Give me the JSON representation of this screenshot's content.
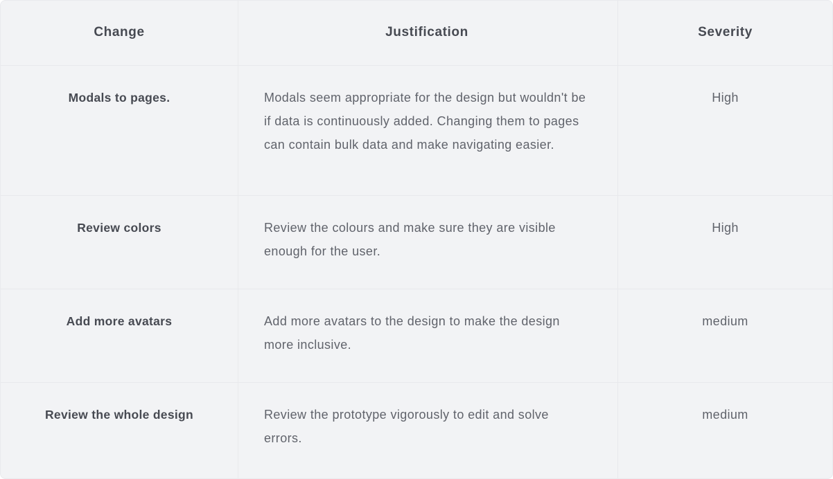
{
  "table": {
    "headers": {
      "change": "Change",
      "justification": "Justification",
      "severity": "Severity"
    },
    "rows": [
      {
        "change": "Modals to pages.",
        "justification": "Modals seem appropriate for the design but wouldn't be if data is continuously added. Changing them to pages can contain bulk data and make navigating easier.",
        "severity": "High"
      },
      {
        "change": "Review colors",
        "justification": "Review the colours and make sure they are visible enough for the user.",
        "severity": "High"
      },
      {
        "change": "Add more avatars",
        "justification": "Add more avatars to the design to make the design more inclusive.",
        "severity": "medium"
      },
      {
        "change": "Review the whole design",
        "justification": "Review the prototype vigorously to edit and solve errors.",
        "severity": "medium"
      }
    ]
  }
}
